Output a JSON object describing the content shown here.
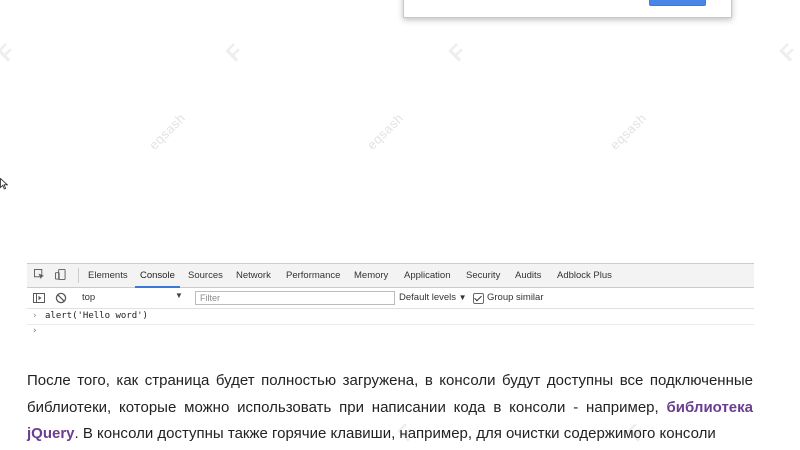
{
  "watermark": {
    "text": "eqsash",
    "brand_letter": "F"
  },
  "devtools": {
    "tabs": [
      "Elements",
      "Console",
      "Sources",
      "Network",
      "Performance",
      "Memory",
      "Application",
      "Security",
      "Audits",
      "Adblock Plus"
    ],
    "active_tab": "Console",
    "toolbar": {
      "context": "top",
      "filter_placeholder": "Filter",
      "levels": "Default levels",
      "group_similar": "Group similar",
      "group_similar_checked": true
    },
    "console": {
      "command": "alert('Hello word')",
      "prompt_symbol": "›"
    }
  },
  "article": {
    "part1": "После того, как страница будет полностью загружена, в консоли будут доступны все подключенные библиотеки, которые можно использовать при написании кода в консоли - например, ",
    "link1": "библиотека jQuery",
    "part2": ". В консоли доступны также горячие клавиши, например, для очистки содержимого консоли"
  }
}
